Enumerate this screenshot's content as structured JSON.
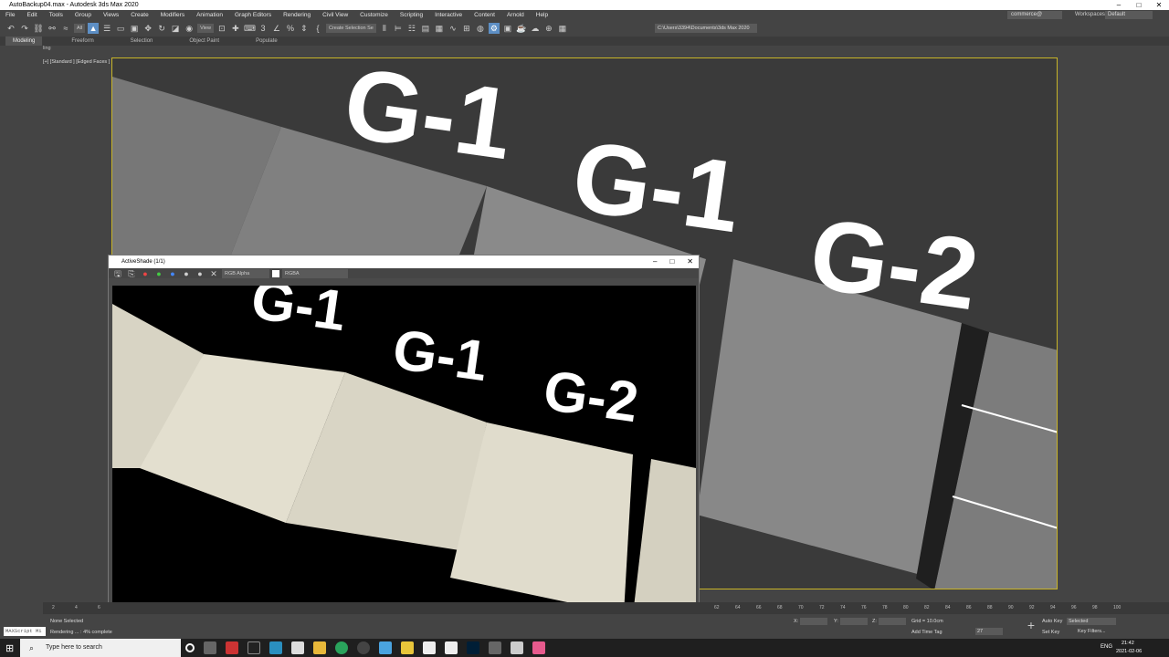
{
  "app": {
    "title": "AutoBackup04.max - Autodesk 3ds Max 2020",
    "window_controls": [
      "–",
      "□",
      "✕"
    ]
  },
  "menu": [
    "File",
    "Edit",
    "Tools",
    "Group",
    "Views",
    "Create",
    "Modifiers",
    "Animation",
    "Graph Editors",
    "Rendering",
    "Civil View",
    "Customize",
    "Scripting",
    "Interactive",
    "Content",
    "Arnold",
    "Help"
  ],
  "account": {
    "user": "commerce@",
    "workspaces_label": "Workspaces:",
    "workspace": "Default"
  },
  "toolbar": {
    "filter": "All",
    "view": "View",
    "selection_set": "Create Selection Se",
    "project_path": "C:\\Users\\3394\\Documents\\3ds Max 2020"
  },
  "ribbon": {
    "tabs": [
      "Modeling",
      "Freeform",
      "Selection",
      "Object Paint",
      "Populate"
    ],
    "subtitle": "ling"
  },
  "viewport": {
    "label": "[+] [Standard ] [Edged Faces ]",
    "text_labels": [
      "G-1",
      "G-1",
      "G-2"
    ]
  },
  "activeshade": {
    "title": "ActiveShade (1/1)",
    "channel": "RGB Alpha",
    "mode": "RGBA",
    "render_labels": [
      "G-1",
      "G-1",
      "G-2"
    ]
  },
  "timeline": {
    "ticks": [
      "2",
      "4",
      "6",
      "62",
      "64",
      "66",
      "68",
      "70",
      "72",
      "74",
      "76",
      "78",
      "80",
      "82",
      "84",
      "86",
      "88",
      "90",
      "92",
      "94",
      "96",
      "98",
      "100"
    ]
  },
  "status": {
    "maxscript": "MAXScript Mi",
    "selection": "None Selected",
    "progress_text": "Rendering ... : 4% complete",
    "progress_percent": 4,
    "x_label": "X:",
    "y_label": "Y:",
    "z_label": "Z:",
    "grid": "Grid = 10.0cm",
    "add_time_tag": "Add Time Tag",
    "frame": "27",
    "auto_key": "Auto Key",
    "set_key": "Set Key",
    "key_selected": "Selected",
    "key_filters": "Key Filters..."
  },
  "taskbar": {
    "search_placeholder": "Type here to search",
    "lang": "ENG",
    "time": "21:42",
    "date": "2021-02-06"
  },
  "colors": {
    "accent": "#5d8fc5",
    "viewport_border": "#c8b428"
  }
}
